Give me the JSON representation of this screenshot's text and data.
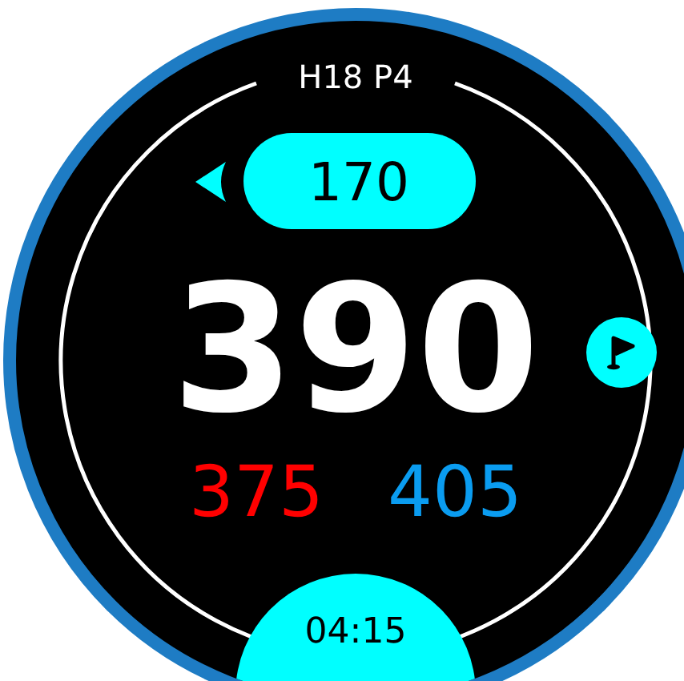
{
  "header": {
    "hole": "H18 P4"
  },
  "layup": {
    "distance": "170"
  },
  "main_distance": "390",
  "edges": [
    {
      "distance": "375",
      "color": "#ff0000"
    },
    {
      "distance": "405",
      "color": "#0a9cf0"
    }
  ],
  "clock": "04:15"
}
